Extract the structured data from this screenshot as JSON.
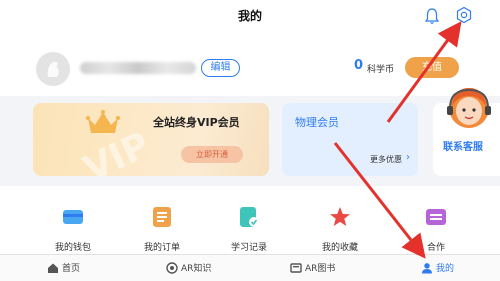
{
  "header": {
    "title": "我的"
  },
  "profile": {
    "edit_label": "编辑",
    "coins": "0",
    "coins_label": "科学币",
    "recharge_label": "充值"
  },
  "vip_card": {
    "watermark": "VIP",
    "title": "全站终身VIP会员",
    "button": "立即开通"
  },
  "physics_card": {
    "title": "物理会员",
    "more": "更多优惠"
  },
  "service": {
    "label": "联系客服"
  },
  "menu": [
    {
      "label": "我的钱包",
      "icon": "wallet-icon"
    },
    {
      "label": "我的订单",
      "icon": "order-icon"
    },
    {
      "label": "学习记录",
      "icon": "study-record-icon"
    },
    {
      "label": "我的收藏",
      "icon": "star-icon"
    },
    {
      "label": "合作",
      "icon": "cooperation-icon"
    }
  ],
  "bottom_nav": [
    {
      "label": "首页",
      "icon": "home-icon"
    },
    {
      "label": "AR知识",
      "icon": "ar-knowledge-icon"
    },
    {
      "label": "AR图书",
      "icon": "ar-book-icon"
    },
    {
      "label": "我的",
      "icon": "user-icon"
    }
  ],
  "colors": {
    "accent": "#2f7cf0",
    "recharge": "#f0a24a",
    "arrow": "#e4312b",
    "vip_card": "#fde9c8",
    "physics_card": "#e3efff"
  }
}
